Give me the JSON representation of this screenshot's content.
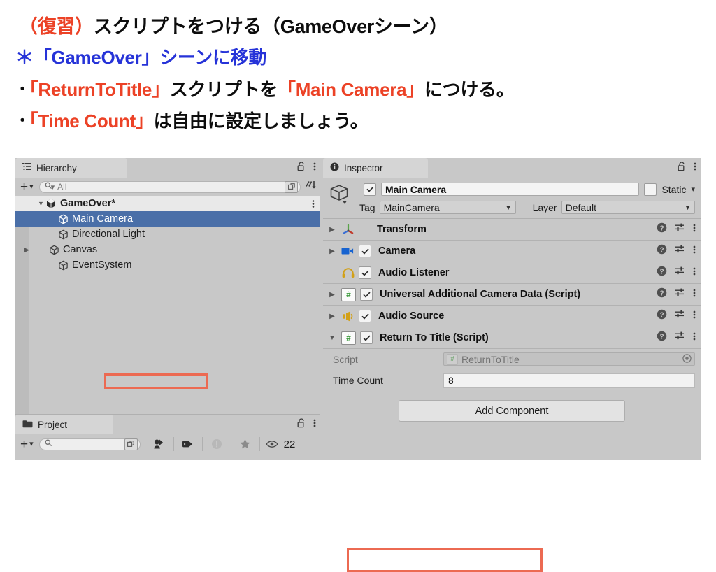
{
  "slide": {
    "line1": {
      "red": "（復習）",
      "black": "スクリプトをつける（GameOverシーン）"
    },
    "line2": {
      "text": "＊「GameOver」シーンに移動"
    },
    "line3": {
      "bullet": "・",
      "red1": "「ReturnToTitle」",
      "black1": "スクリプトを",
      "red2": "「Main Camera」",
      "black2": "につける。"
    },
    "line4": {
      "bullet": "・",
      "red1": "「Time Count」",
      "black1": "は自由に設定しましょう。"
    },
    "colors": {
      "red": "#ec4226",
      "blue": "#2633d8",
      "black": "#0d0d0d"
    }
  },
  "hierarchy": {
    "tab_label": "Hierarchy",
    "tab_icon": "hierarchy-list-icon",
    "lock_icon": "lock-open-icon",
    "menu_icon": "kebab-menu-icon",
    "add_label": "+",
    "search_placeholder": "All",
    "search_value": "",
    "sort_icon": "alphabetical-sort-icon",
    "rows": [
      {
        "label": "GameOver*",
        "indent": 0,
        "arrow": "down",
        "selected": false,
        "root": true
      },
      {
        "label": "Main Camera",
        "indent": 1,
        "arrow": "none",
        "selected": true,
        "root": false
      },
      {
        "label": "Directional Light",
        "indent": 1,
        "arrow": "none",
        "selected": false,
        "root": false
      },
      {
        "label": "Canvas",
        "indent": 1,
        "arrow": "right",
        "selected": false,
        "root": false
      },
      {
        "label": "EventSystem",
        "indent": 1,
        "arrow": "none",
        "selected": false,
        "root": false
      }
    ]
  },
  "project": {
    "tab_label": "Project",
    "tab_icon": "folder-icon",
    "lock_icon": "lock-open-icon",
    "menu_icon": "kebab-menu-icon",
    "add_label": "+",
    "search_placeholder": "",
    "search_value": "",
    "toolbar_icons": [
      "avatar-mask-icon",
      "label-tag-icon",
      "warning-circle-icon",
      "star-favorite-icon",
      "eye-visibility-icon"
    ],
    "visible_count": "22"
  },
  "inspector": {
    "tab_label": "Inspector",
    "tab_icon": "info-circle-icon",
    "lock_icon": "lock-open-icon",
    "menu_icon": "kebab-menu-icon",
    "object_icon": "gameobject-cube-icon",
    "enabled": true,
    "name": "Main Camera",
    "static_label": "Static",
    "static_checked": false,
    "tag_label": "Tag",
    "tag_value": "MainCamera",
    "layer_label": "Layer",
    "layer_value": "Default",
    "components": [
      {
        "name": "Transform",
        "icon": "transform-axis-icon",
        "arrow": "right",
        "has_checkbox": false,
        "enabled": false
      },
      {
        "name": "Camera",
        "icon": "camera-icon",
        "arrow": "right",
        "has_checkbox": true,
        "enabled": true
      },
      {
        "name": "Audio Listener",
        "icon": "headphones-icon",
        "arrow": "none",
        "has_checkbox": true,
        "enabled": true
      },
      {
        "name": "Universal Additional Camera Data (Script)",
        "icon": "cs-script-icon",
        "arrow": "right",
        "has_checkbox": true,
        "enabled": true
      },
      {
        "name": "Audio Source",
        "icon": "speaker-icon",
        "arrow": "right",
        "has_checkbox": true,
        "enabled": true
      },
      {
        "name": "Return To Title (Script)",
        "icon": "cs-script-icon",
        "arrow": "down",
        "has_checkbox": true,
        "enabled": true
      }
    ],
    "row_icons": {
      "help": "help-circle-icon",
      "preset": "preset-sliders-icon",
      "menu": "kebab-menu-icon"
    },
    "script_block": {
      "script_label": "Script",
      "script_value": "ReturnToTitle",
      "script_icon": "cs-script-icon",
      "object_picker_icon": "target-dot-icon",
      "prop_label": "Time Count",
      "prop_value": "8"
    },
    "add_component_label": "Add Component"
  },
  "annotations": {
    "box_color": "#ec6a52",
    "targets": [
      "main-camera-hierarchy-row",
      "time-count-property-row"
    ]
  }
}
